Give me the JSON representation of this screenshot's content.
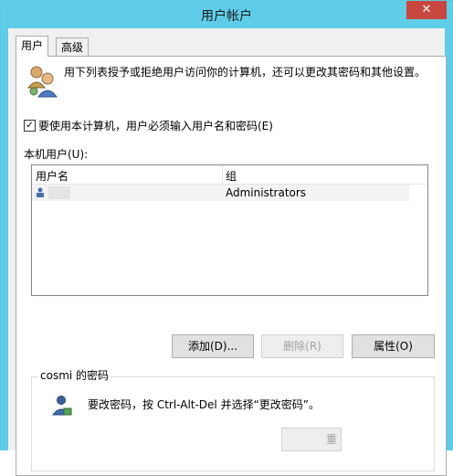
{
  "window": {
    "title": "用户帐户",
    "close_glyph": "✕"
  },
  "tabs": [
    {
      "label": "用户"
    },
    {
      "label": "高级"
    }
  ],
  "users_tab": {
    "description": "用下列表授予或拒绝用户访问你的计算机，还可以更改其密码和其他设置。",
    "require_login_checkbox": {
      "label": "要使用本计算机，用户必须输入用户名和密码(E)",
      "checked": true,
      "check_glyph": "✓"
    },
    "local_users_label": "本机用户(U):",
    "table": {
      "columns": [
        "用户名",
        "组"
      ],
      "rows": [
        {
          "username": "",
          "group": "Administrators"
        }
      ]
    },
    "buttons": {
      "add": "添加(D)...",
      "remove": "删除(R)",
      "properties": "属性(O)"
    },
    "password_group": {
      "legend": "cosmi 的密码",
      "text": "要改密码，按 Ctrl-Alt-Del 并选择“更改密码”。",
      "reset_button": "重"
    }
  },
  "colors": {
    "titlebar": "#60cde8",
    "close": "#c7463e"
  }
}
